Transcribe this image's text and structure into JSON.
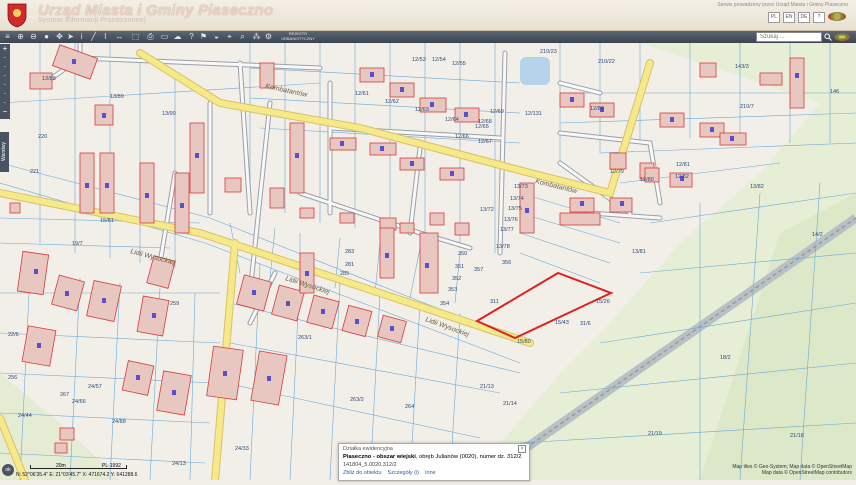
{
  "header": {
    "title": "Urząd Miasta i Gminy Piaseczno",
    "subtitle": "System Informacji Przestrzennej",
    "note": "Serwis prowadzony przez Urząd Miasta i Gminy Piaseczno",
    "crest_label": "Piaseczno",
    "lang_icons": [
      "PL",
      "EN",
      "DE",
      "?"
    ]
  },
  "toolbar": {
    "rejestr_label": "REJESTR URBANISTYCZNY",
    "search_placeholder": "Szukaj ..."
  },
  "side": {
    "warstwy_label": "Warstwy"
  },
  "map": {
    "road_color": "#f3e27a",
    "parcel_line_color": "#6aa9d8",
    "building_color": "#e8c7c0",
    "highlight_color": "#e02020",
    "street_labels": [
      "Kombatantów",
      "Lidii Wysockiej",
      "Lidii Wysockiej",
      "Lidii Wysockiej",
      "Kombatantów"
    ],
    "parcel_labels": [
      "13/88",
      "13/89",
      "13/90",
      "220",
      "221",
      "19/7",
      "22/6",
      "256",
      "259",
      "267",
      "263/1",
      "263/2",
      "264",
      "24/44",
      "24/66",
      "24/57",
      "24/88",
      "24/33",
      "24/13",
      "15/81",
      "15/80",
      "15/43",
      "15/26",
      "31/6",
      "18/2",
      "21/13",
      "21/14",
      "21/19",
      "21/18",
      "13/81",
      "13/82",
      "14/2",
      "12/131",
      "12/82",
      "12/81",
      "12/80",
      "12/79",
      "12/88",
      "13/72",
      "13/73",
      "13/74",
      "13/75",
      "13/76",
      "13/77",
      "13/78",
      "350",
      "351",
      "352",
      "353",
      "354",
      "356",
      "357",
      "311",
      "281",
      "283",
      "285",
      "210/23",
      "210/22",
      "143/3",
      "146",
      "210/7",
      "12/53",
      "12/54",
      "12/55",
      "12/61",
      "12/62",
      "12/63",
      "12/64",
      "12/65",
      "12/66",
      "12/67",
      "12/68",
      "12/69"
    ]
  },
  "popup": {
    "heading": "Działka ewidencyjna",
    "line1_prefix": "Piaseczno - obszar wiejski",
    "line1_rest": ", obręb Julianów (0020), numer dz. 312/2",
    "line2": "141804_5.0020.312/2",
    "link_zoom": "Zbliż do obiektu",
    "link_details": "Szczegóły (i)",
    "link_other": "Inne"
  },
  "status": {
    "scale_label": "20m",
    "scale_select": "PL-1992",
    "coords": "N: 52°06'35.4\" E: 21°03'45.7\" X: 471674.2 Y: 641288.6",
    "attribution": [
      "Map tiles © Geo-System; Map data © OpenStreetMap",
      "Map data © OpenStreetMap contributors"
    ]
  }
}
